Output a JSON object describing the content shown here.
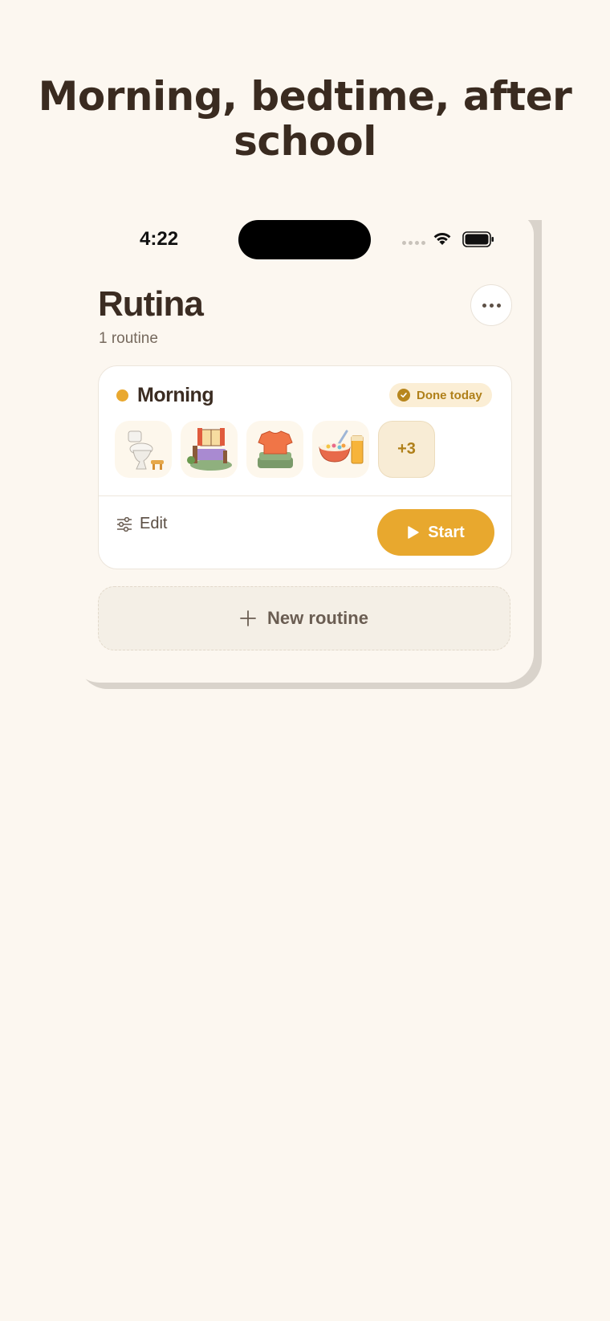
{
  "headline": "Morning, bedtime, after school",
  "status_bar": {
    "time": "4:22"
  },
  "app": {
    "title": "Rutina",
    "subtitle": "1 routine",
    "more_icon": "ellipsis-icon"
  },
  "routine_card": {
    "name": "Morning",
    "accent_color": "#e9a82f",
    "status_badge": "Done today",
    "steps": [
      {
        "icon": "toilet-icon"
      },
      {
        "icon": "make-bed-icon"
      },
      {
        "icon": "folded-clothes-icon"
      },
      {
        "icon": "cereal-breakfast-icon"
      }
    ],
    "more_steps": "+3",
    "edit_label": "Edit",
    "start_label": "Start"
  },
  "new_routine": {
    "label": "New routine"
  },
  "colors": {
    "background": "#fcf7f0",
    "primary": "#e8a82e",
    "text": "#3b2c22"
  }
}
